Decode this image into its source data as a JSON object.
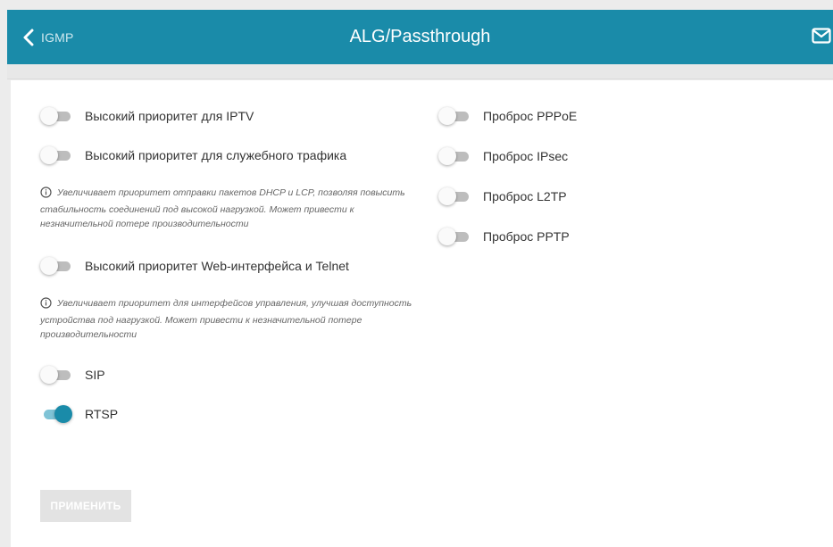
{
  "header": {
    "back_label": "IGMP",
    "title": "ALG/Passthrough",
    "mail_icon": "mail-icon",
    "back_icon": "chevron-left-icon"
  },
  "colors": {
    "header_bg": "#1a8ba9",
    "toggle_on": "#1a8ba9",
    "toggle_track_off": "#bdbdbd"
  },
  "left_column": {
    "iptv": {
      "label": "Высокий приоритет для IPTV",
      "enabled": false
    },
    "service_traffic": {
      "label": "Высокий приоритет для служебного трафика",
      "enabled": false,
      "hint": "Увеличивает приоритет отправки пакетов DHCP и LCP, позволяя повысить стабильность соединений под высокой нагрузкой. Может привести к незначительной потере производительности"
    },
    "web_telnet": {
      "label": "Высокий приоритет Web-интерфейса и Telnet",
      "enabled": false,
      "hint": "Увеличивает приоритет для интерфейсов управления, улучшая доступность устройства под нагрузкой. Может привести к незначительной потере производительности"
    },
    "sip": {
      "label": "SIP",
      "enabled": false
    },
    "rtsp": {
      "label": "RTSP",
      "enabled": true
    }
  },
  "right_column": {
    "pppoe": {
      "label": "Проброс PPPoE",
      "enabled": false
    },
    "ipsec": {
      "label": "Проброс IPsec",
      "enabled": false
    },
    "l2tp": {
      "label": "Проброс L2TP",
      "enabled": false
    },
    "pptp": {
      "label": "Проброс PPTP",
      "enabled": false
    }
  },
  "apply_button": {
    "label": "ПРИМЕНИТЬ",
    "disabled": true
  }
}
